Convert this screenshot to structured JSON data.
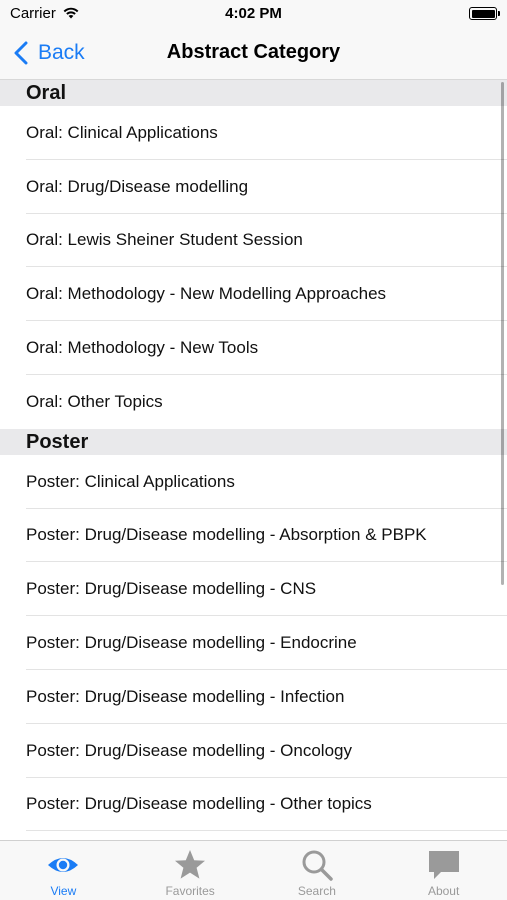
{
  "status_bar": {
    "carrier": "Carrier",
    "time": "4:02 PM"
  },
  "nav": {
    "back_label": "Back",
    "title": "Abstract Category"
  },
  "sections": [
    {
      "header": "Oral",
      "rows": [
        "Oral: Clinical Applications",
        "Oral: Drug/Disease modelling",
        "Oral: Lewis Sheiner Student Session",
        "Oral: Methodology - New Modelling Approaches",
        "Oral: Methodology - New Tools",
        "Oral: Other Topics"
      ]
    },
    {
      "header": "Poster",
      "rows": [
        "Poster: Clinical Applications",
        "Poster: Drug/Disease modelling - Absorption & PBPK",
        "Poster: Drug/Disease modelling - CNS",
        "Poster: Drug/Disease modelling - Endocrine",
        "Poster: Drug/Disease modelling - Infection",
        "Poster: Drug/Disease modelling - Oncology",
        "Poster: Drug/Disease modelling - Other topics"
      ]
    }
  ],
  "tabs": [
    {
      "label": "View",
      "icon": "eye-icon",
      "active": true
    },
    {
      "label": "Favorites",
      "icon": "star-icon",
      "active": false
    },
    {
      "label": "Search",
      "icon": "search-icon",
      "active": false
    },
    {
      "label": "About",
      "icon": "chat-bubble-icon",
      "active": false
    }
  ],
  "colors": {
    "accent": "#1a7cf5",
    "inactive_tab": "#9a9a9a",
    "section_header_bg": "#e9e9eb"
  }
}
